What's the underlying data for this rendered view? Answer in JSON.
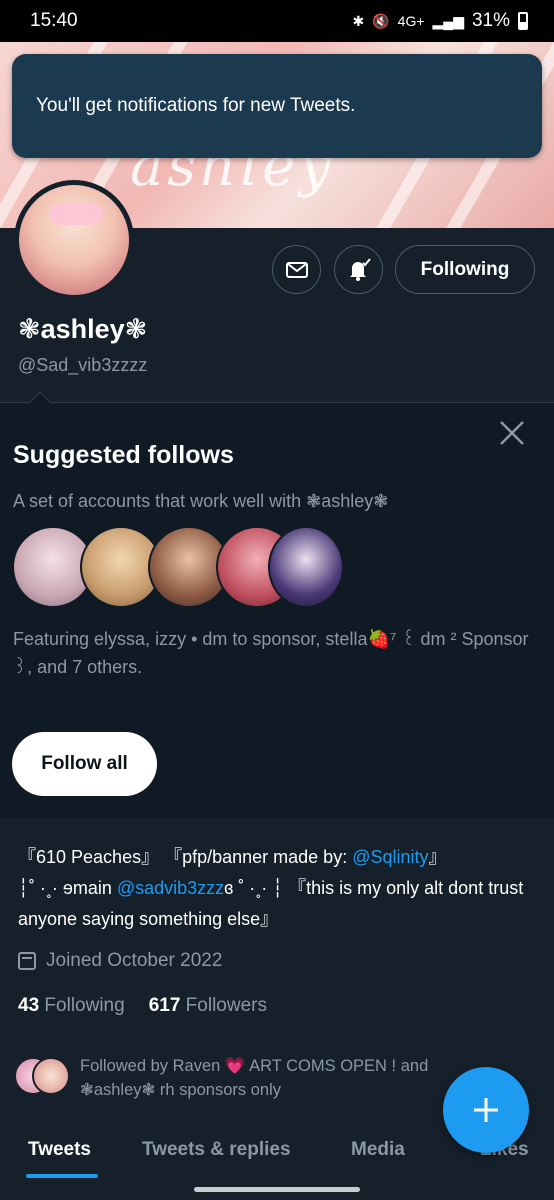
{
  "status_bar": {
    "time": "15:40",
    "network": "4G+",
    "battery": "31%"
  },
  "toast": {
    "message": "You'll get notifications for new Tweets."
  },
  "banner": {
    "text": "ashley"
  },
  "profile": {
    "display_name": "❃ashley❃",
    "handle": "@Sad_vib3zzzz",
    "following_button": "Following",
    "bio_line1_a": "『610 Peaches』 『pfp/banner made by: ",
    "bio_link1": "@Sqlinity",
    "bio_line1_b": "』",
    "bio_line2_a": "┆˚ ·˳· ɘmain ",
    "bio_link2": "@sadvib3zzz",
    "bio_line2_b": "ɞ ˚ ·˳· ┆ 『this is my only alt dont trust anyone saying something else』",
    "joined": "Joined October 2022",
    "following_count": "43",
    "following_label": "Following",
    "followers_count": "617",
    "followers_label": "Followers",
    "followed_by": "Followed by Raven 💗 ART COMS OPEN ! and ❃ashley❃ rh sponsors only"
  },
  "suggested": {
    "title": "Suggested follows",
    "subtitle": "A set of accounts that work well with ❃ashley❃",
    "featuring": "Featuring elyssa, izzy • dm to sponsor, stella🍓⁷ ꒰ dm ² Sponsor ꒱, and 7 others.",
    "follow_all": "Follow all"
  },
  "tabs": [
    "Tweets",
    "Tweets & replies",
    "Media",
    "Likes"
  ],
  "colors": {
    "accent": "#1d9bf0",
    "background": "#15202b",
    "muted": "#8b98a5"
  }
}
